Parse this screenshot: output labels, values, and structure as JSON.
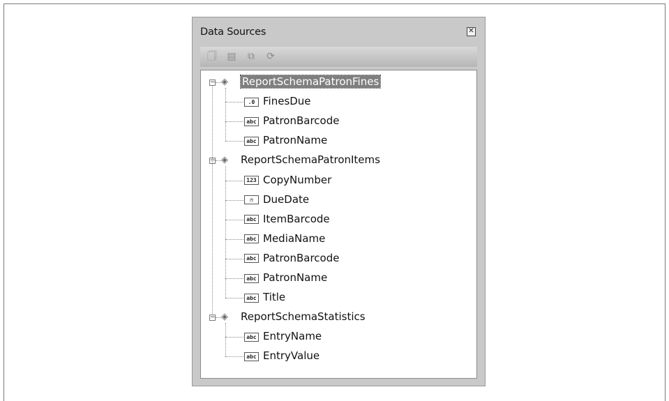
{
  "panel": {
    "title": "Data Sources",
    "close_glyph": "✕",
    "toolbar": [
      {
        "icon": "add-data-source-icon",
        "glyph": "🗍"
      },
      {
        "icon": "configure-data-source-icon",
        "glyph": "▤"
      },
      {
        "icon": "edit-dataset-icon",
        "glyph": "⧉"
      },
      {
        "icon": "refresh-icon",
        "glyph": "⟳"
      }
    ]
  },
  "tree": {
    "datasets": [
      {
        "name": "ReportSchemaPatronFines",
        "selected": true,
        "fields": [
          {
            "name": "FinesDue",
            "type_badge": ".0"
          },
          {
            "name": "PatronBarcode",
            "type_badge": "abc"
          },
          {
            "name": "PatronName",
            "type_badge": "abc"
          }
        ]
      },
      {
        "name": "ReportSchemaPatronItems",
        "selected": false,
        "fields": [
          {
            "name": "CopyNumber",
            "type_badge": "123"
          },
          {
            "name": "DueDate",
            "type_badge": "◷"
          },
          {
            "name": "ItemBarcode",
            "type_badge": "abc"
          },
          {
            "name": "MediaName",
            "type_badge": "abc"
          },
          {
            "name": "PatronBarcode",
            "type_badge": "abc"
          },
          {
            "name": "PatronName",
            "type_badge": "abc"
          },
          {
            "name": "Title",
            "type_badge": "abc"
          }
        ]
      },
      {
        "name": "ReportSchemaStatistics",
        "selected": false,
        "fields": [
          {
            "name": "EntryName",
            "type_badge": "abc"
          },
          {
            "name": "EntryValue",
            "type_badge": "abc"
          }
        ]
      }
    ],
    "collapse_glyph": "−"
  }
}
